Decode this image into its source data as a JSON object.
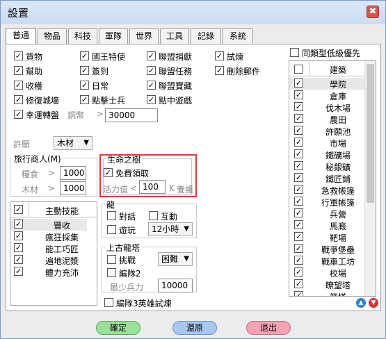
{
  "window": {
    "title": "設置",
    "close_glyph": "✖"
  },
  "tabs": [
    {
      "label": "普通",
      "active": true
    },
    {
      "label": "物品"
    },
    {
      "label": "科技"
    },
    {
      "label": "軍隊"
    },
    {
      "label": "世界"
    },
    {
      "label": "工具"
    },
    {
      "label": "記錄"
    },
    {
      "label": "系統"
    }
  ],
  "general": {
    "checkboxes": [
      {
        "label": "貨物",
        "checked": true
      },
      {
        "label": "幫助",
        "checked": true
      },
      {
        "label": "收穫",
        "checked": true
      },
      {
        "label": "修復城墻",
        "checked": true
      },
      {
        "label": "幸運轉盤",
        "checked": true
      },
      {
        "label": "國王特使",
        "checked": true
      },
      {
        "label": "簽到",
        "checked": true
      },
      {
        "label": "日常",
        "checked": true
      },
      {
        "label": "點擊士兵",
        "checked": true
      },
      {
        "label": "聯盟捐獻",
        "checked": true
      },
      {
        "label": "聯盟任務",
        "checked": true
      },
      {
        "label": "聯盟寶藏",
        "checked": true
      },
      {
        "label": "點中遊戲",
        "checked": true
      },
      {
        "label": "試煉",
        "checked": true
      },
      {
        "label": "刪除郵件",
        "checked": true
      }
    ],
    "copper_label": "銅幣",
    "copper_op": ">",
    "copper_value": "30000"
  },
  "wish": {
    "label": "許願",
    "value": "木材"
  },
  "merchant": {
    "title": "旅行商人(M)",
    "food_label": "糧食",
    "food_op": ">",
    "food_value": "1000",
    "wood_label": "木材",
    "wood_op": ">",
    "wood_value": "1000"
  },
  "life_tree": {
    "title": "生命之樹",
    "free_label": "免費領取",
    "free_checked": true,
    "vitality_label": "活力值",
    "vitality_op": "<",
    "vitality_value": "100",
    "unit": "K",
    "nourish_label": "養護"
  },
  "skills": {
    "header": "主動技能",
    "header_checked": true,
    "items": [
      {
        "label": "豐收",
        "checked": true
      },
      {
        "label": "瘋狂採集",
        "checked": true
      },
      {
        "label": "能工巧匠",
        "checked": true
      },
      {
        "label": "遍地泥漿",
        "checked": true
      },
      {
        "label": "體力充沛",
        "checked": true
      }
    ]
  },
  "dragon": {
    "title": "龍",
    "dialogue_label": "對話",
    "interact_label": "互動",
    "play_label": "遊玩",
    "hours_value": "12小時"
  },
  "ancient_dragon": {
    "title": "上古龍塔",
    "challenge_label": "挑戰",
    "difficulty_value": "困難",
    "team2_label": "編隊2",
    "min_troops_label": "最少兵力",
    "min_troops_value": "10000"
  },
  "team3_label": "編隊3英雄試煉",
  "buildings": {
    "same_type_label": "同類型低級優先",
    "header": "建築",
    "items": [
      {
        "label": "學院",
        "checked": true
      },
      {
        "label": "倉庫",
        "checked": true
      },
      {
        "label": "伐木場",
        "checked": true
      },
      {
        "label": "農田",
        "checked": true
      },
      {
        "label": "許願池",
        "checked": true
      },
      {
        "label": "市場",
        "checked": true
      },
      {
        "label": "鐵礦場",
        "checked": true
      },
      {
        "label": "秘銀礦",
        "checked": true
      },
      {
        "label": "鐵匠鋪",
        "checked": true
      },
      {
        "label": "急救帳篷",
        "checked": true
      },
      {
        "label": "行軍帳篷",
        "checked": true
      },
      {
        "label": "兵營",
        "checked": true
      },
      {
        "label": "馬廄",
        "checked": true
      },
      {
        "label": "靶場",
        "checked": true
      },
      {
        "label": "戰爭堡壘",
        "checked": true
      },
      {
        "label": "戰車工坊",
        "checked": true
      },
      {
        "label": "校場",
        "checked": true
      },
      {
        "label": "瞭望塔",
        "checked": true
      },
      {
        "label": "箭塔",
        "checked": true
      }
    ]
  },
  "buttons": {
    "ok": "確定",
    "restore": "還原",
    "exit": "退出"
  },
  "colors": {
    "ok": "#9be09b",
    "restore": "#a9c8ef",
    "exit": "#f4a3b3",
    "red_box": "#e53935"
  }
}
